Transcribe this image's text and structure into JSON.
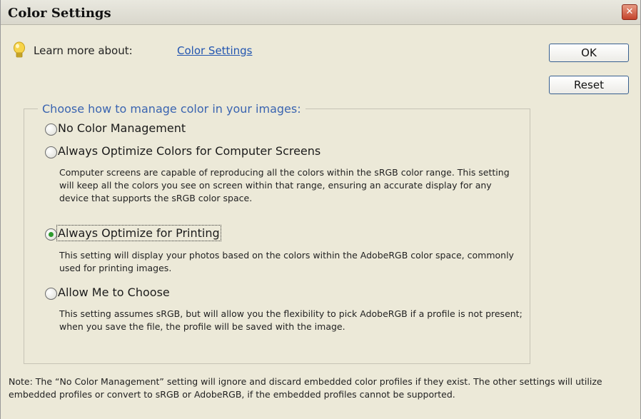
{
  "window": {
    "title": "Color Settings"
  },
  "learn": {
    "prefix": "Learn more about:",
    "link": "Color Settings"
  },
  "buttons": {
    "ok": "OK",
    "reset": "Reset"
  },
  "group": {
    "legend": "Choose how to manage color in your images:",
    "options": [
      {
        "label": "No Color Management",
        "selected": false,
        "description": ""
      },
      {
        "label": "Always Optimize Colors for Computer Screens",
        "selected": false,
        "description": "Computer screens are capable of reproducing all the colors within the sRGB color range. This setting will keep all the colors you see on screen within that range, ensuring an accurate display for any device that supports the sRGB color space."
      },
      {
        "label": "Always Optimize for Printing",
        "selected": true,
        "description": "This setting will display your photos based on the colors within the AdobeRGB color space, commonly used for printing images."
      },
      {
        "label": "Allow Me to Choose",
        "selected": false,
        "description": "This setting assumes sRGB, but will allow you the flexibility to pick AdobeRGB if a profile is not present; when you save the file, the profile will be saved with the image."
      }
    ]
  },
  "note": "Note: The “No Color Management” setting will ignore and discard embedded color profiles if they exist. The other settings will utilize embedded profiles or convert to sRGB or AdobeRGB, if the embedded profiles cannot be supported."
}
